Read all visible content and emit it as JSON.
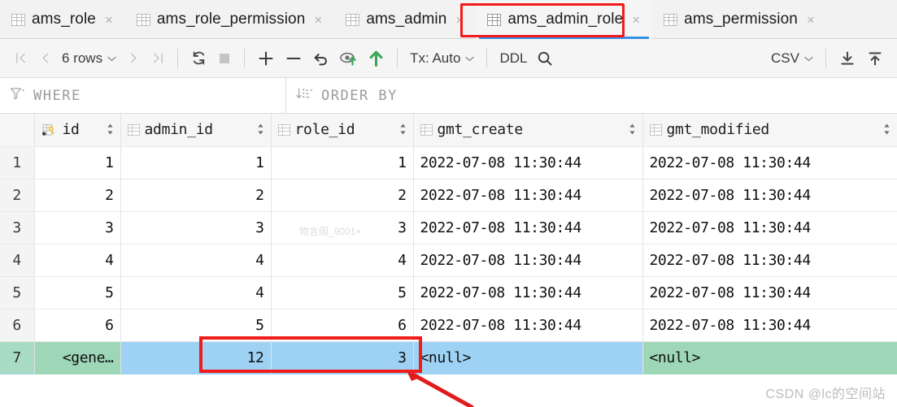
{
  "tabs": [
    {
      "label": "ams_role",
      "icon": "table-icon",
      "active": false
    },
    {
      "label": "ams_role_permission",
      "icon": "table-icon",
      "active": false
    },
    {
      "label": "ams_admin",
      "icon": "table-icon",
      "active": false
    },
    {
      "label": "ams_admin_role",
      "icon": "table-icon",
      "active": true
    },
    {
      "label": "ams_permission",
      "icon": "table-icon",
      "active": false
    }
  ],
  "tab_close_glyph": "×",
  "toolbar": {
    "first_page": "|❮",
    "prev_page": "❮",
    "row_count": "6 rows",
    "next_page": "❯",
    "last_page": "❯|",
    "refresh": "refresh-icon",
    "stop": "stop-icon",
    "add_row": "+",
    "delete_row": "−",
    "revert": "revert-icon",
    "commit_preview": "preview-commit-icon",
    "commit": "commit-icon",
    "tx_label": "Tx: Auto",
    "ddl_label": "DDL",
    "search": "search-icon",
    "export_format": "CSV",
    "download": "download-icon",
    "upload": "upload-icon",
    "caret": "⌄"
  },
  "filter": {
    "where_label": "WHERE",
    "where_icon": "filter-icon",
    "order_label": "ORDER BY",
    "order_icon": "sort-icon"
  },
  "grid": {
    "columns": [
      {
        "name": "id",
        "icon": "primary-key-icon",
        "align": "num"
      },
      {
        "name": "admin_id",
        "icon": "column-icon",
        "align": "num"
      },
      {
        "name": "role_id",
        "icon": "column-icon",
        "align": "num"
      },
      {
        "name": "gmt_create",
        "icon": "column-icon",
        "align": "txt"
      },
      {
        "name": "gmt_modified",
        "icon": "column-icon",
        "align": "txt"
      }
    ],
    "sort_glyph": "↕",
    "rows": [
      {
        "n": "1",
        "id": "1",
        "admin_id": "1",
        "role_id": "1",
        "gmt_create": "2022-07-08 11:30:44",
        "gmt_modified": "2022-07-08 11:30:44",
        "selected": false,
        "modified": []
      },
      {
        "n": "2",
        "id": "2",
        "admin_id": "2",
        "role_id": "2",
        "gmt_create": "2022-07-08 11:30:44",
        "gmt_modified": "2022-07-08 11:30:44",
        "selected": false,
        "modified": []
      },
      {
        "n": "3",
        "id": "3",
        "admin_id": "3",
        "role_id": "3",
        "gmt_create": "2022-07-08 11:30:44",
        "gmt_modified": "2022-07-08 11:30:44",
        "selected": false,
        "modified": []
      },
      {
        "n": "4",
        "id": "4",
        "admin_id": "4",
        "role_id": "4",
        "gmt_create": "2022-07-08 11:30:44",
        "gmt_modified": "2022-07-08 11:30:44",
        "selected": false,
        "modified": []
      },
      {
        "n": "5",
        "id": "5",
        "admin_id": "4",
        "role_id": "5",
        "gmt_create": "2022-07-08 11:30:44",
        "gmt_modified": "2022-07-08 11:30:44",
        "selected": false,
        "modified": []
      },
      {
        "n": "6",
        "id": "6",
        "admin_id": "5",
        "role_id": "6",
        "gmt_create": "2022-07-08 11:30:44",
        "gmt_modified": "2022-07-08 11:30:44",
        "selected": false,
        "modified": []
      },
      {
        "n": "7",
        "id": "<gene…",
        "admin_id": "12",
        "role_id": "3",
        "gmt_create": "<null>",
        "gmt_modified": "<null>",
        "selected": true,
        "modified": [
          "id",
          "gmt_modified"
        ]
      }
    ]
  },
  "annotations": {
    "watermark": "CSDN @lc的空间站",
    "faint_watermark": "物言阁_9001×",
    "highlight_color": "#f21b1b",
    "selection_color": "#9ed2f5",
    "modified_color": "#9ed7b8",
    "tab_underline_color": "#3a8ee6"
  }
}
